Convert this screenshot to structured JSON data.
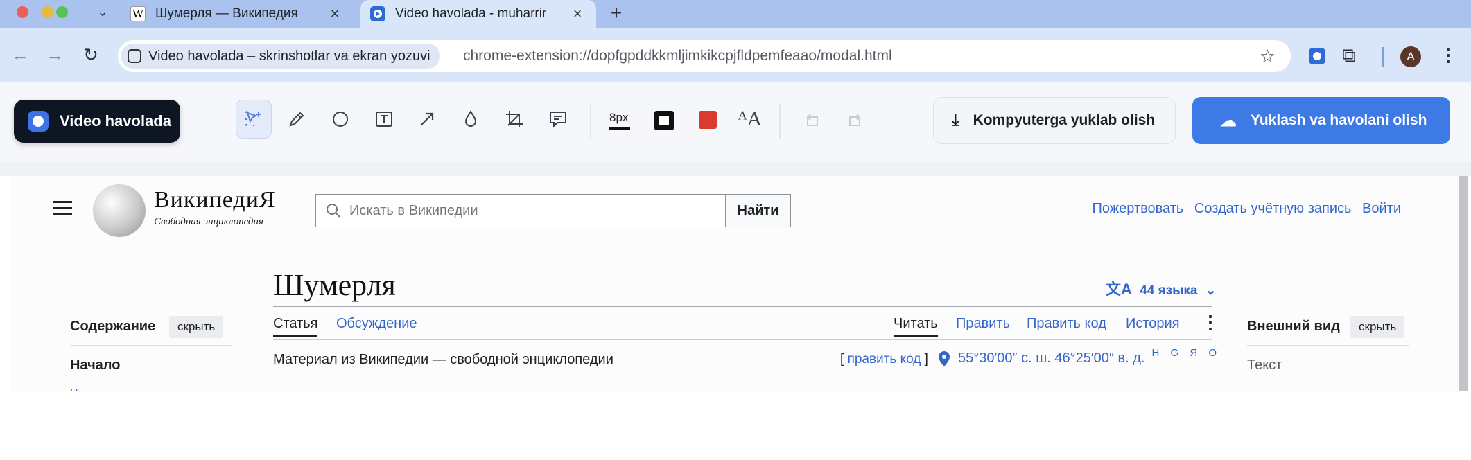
{
  "browser": {
    "tabs": [
      {
        "label": "Шумерля — Википедия",
        "favicon": "wikipedia-W",
        "close": "×"
      },
      {
        "label": "Video havolada - muharrir",
        "favicon": "video-havolada",
        "close": "×",
        "active": true
      }
    ],
    "new_tab": "+",
    "tabs_menu": "⌄",
    "nav": {
      "back": "←",
      "forward": "→",
      "reload": "↻"
    },
    "site_chip": "Video havolada – skrinshotlar va ekran yozuvi",
    "url": "chrome-extension://dopfgpddkkmljimkikcpjfldpemfeaao/modal.html",
    "bookmark": "☆",
    "avatar": "A",
    "menu": "⋮"
  },
  "editor": {
    "brand": "Video havolada",
    "stroke_size": "8px",
    "colors": {
      "stroke": "#111111",
      "fill": "#d93b2e",
      "accent": "#3d7ae6"
    },
    "download_label": "Kompyuterga yuklab olish",
    "upload_label": "Yuklash va havolani olish",
    "tools": [
      "select-add",
      "pencil",
      "ellipse",
      "text",
      "arrow",
      "blur-drop",
      "crop",
      "comment"
    ]
  },
  "wiki": {
    "title": "ВикипедиЯ",
    "subtitle": "Свободная энциклопедия",
    "search_placeholder": "Искать в Википедии",
    "search_button": "Найти",
    "header_links": [
      "Пожертвовать",
      "Создать учётную запись",
      "Войти"
    ],
    "article_title": "Шумерля",
    "languages": "44 языка",
    "tabs_left": [
      "Статья",
      "Обсуждение"
    ],
    "tabs_right": [
      "Читать",
      "Править",
      "Править код",
      "История"
    ],
    "toc_heading": "Содержание",
    "hide": "скрыть",
    "toc_start": "Начало",
    "toc_next": "Н",
    "appearance_heading": "Внешний вид",
    "appearance_text": "Текст",
    "from_wiki": "Материал из Википедии — свободной энциклопедии",
    "edit_code_open": "[",
    "edit_code": "править код",
    "edit_code_close": "]",
    "coordinates": "55°30′00″ с. ш. 46°25′00″ в. д.",
    "coord_links": "H G Я O"
  }
}
